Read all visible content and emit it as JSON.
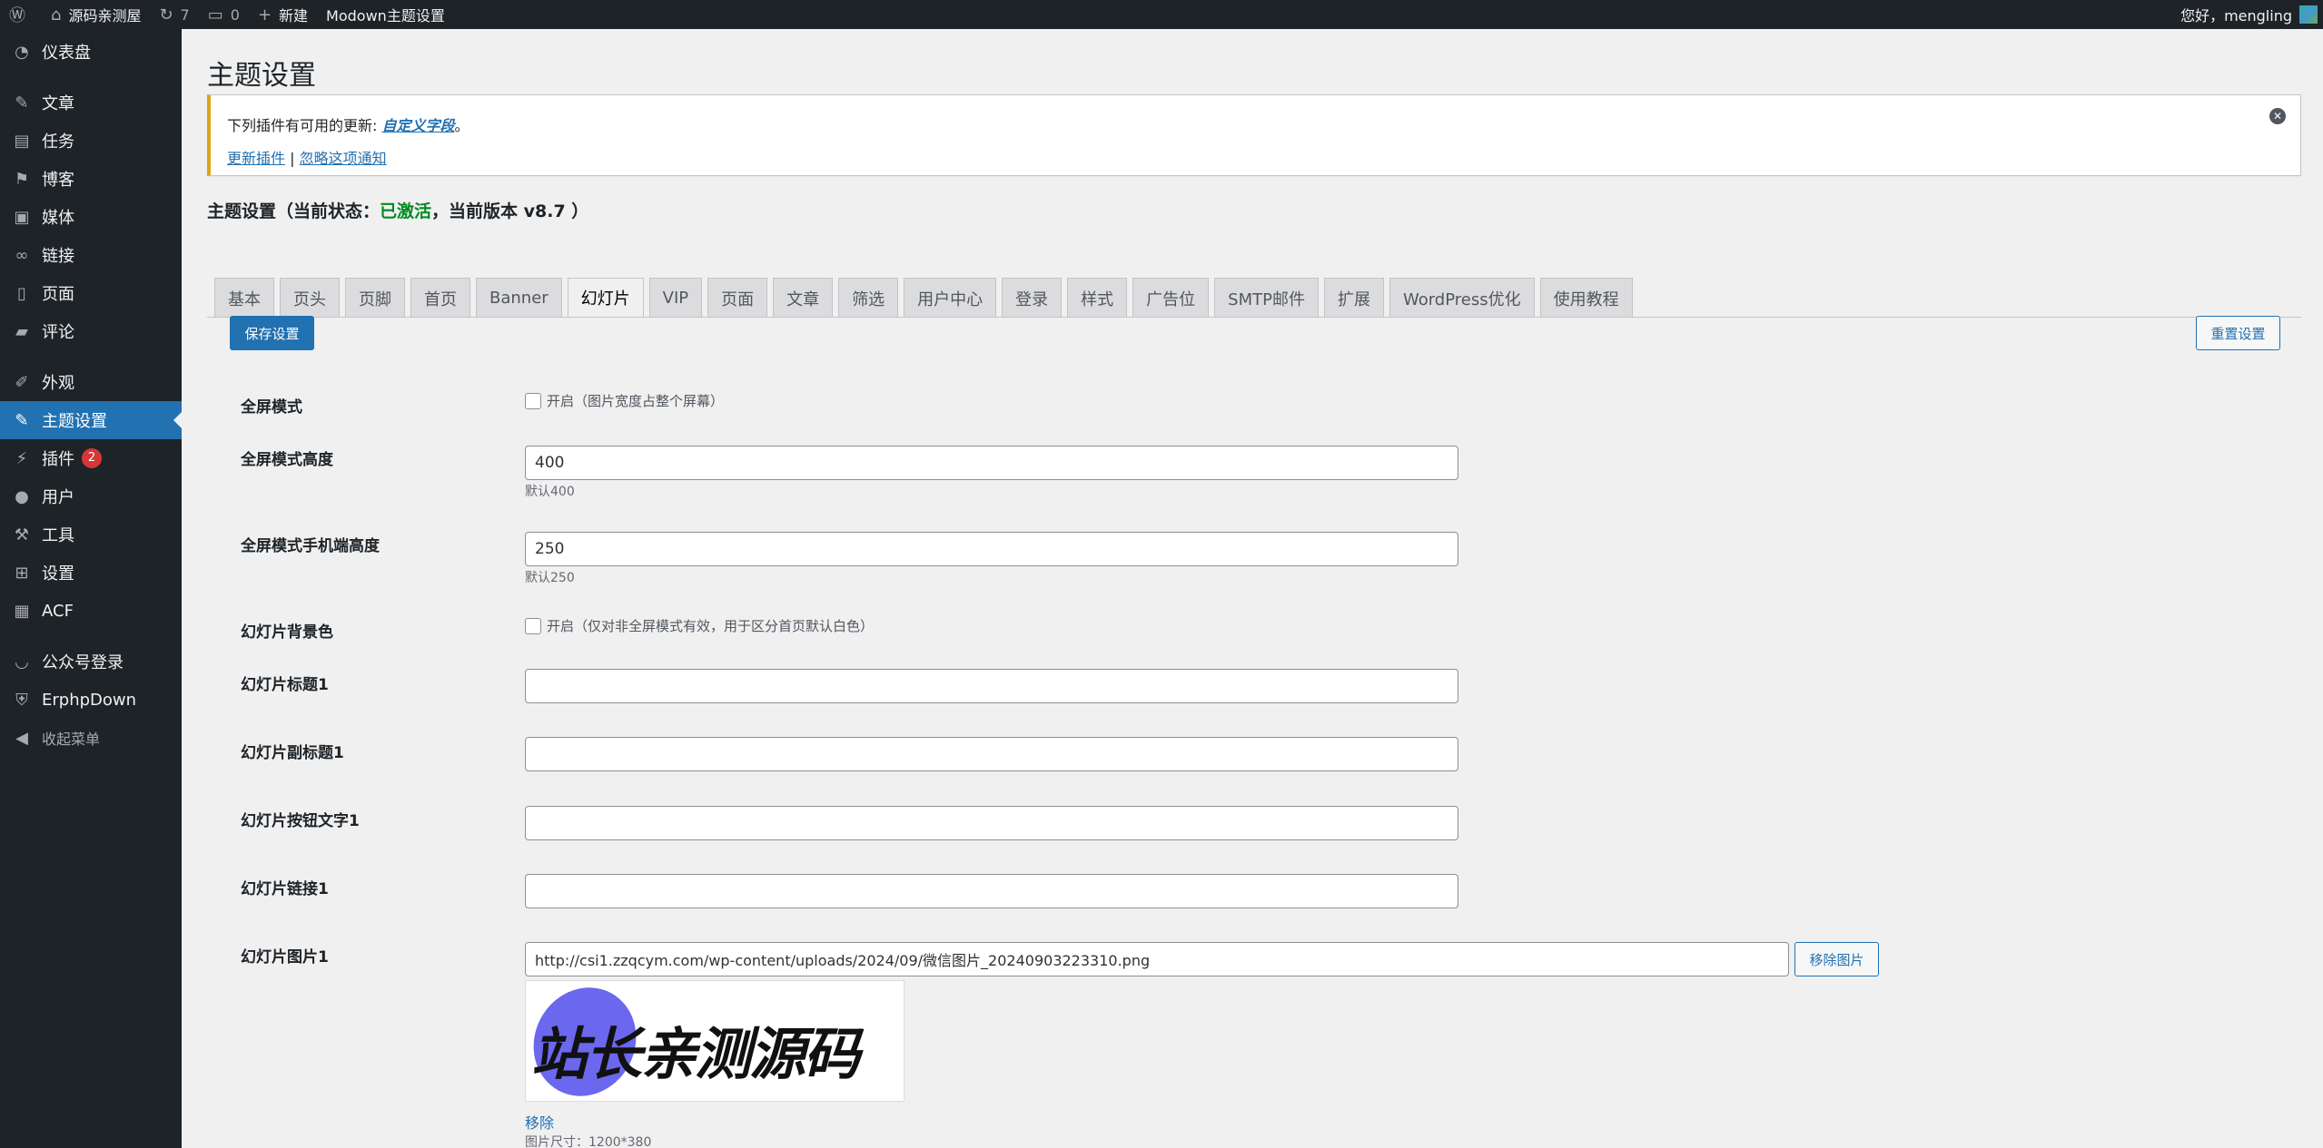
{
  "adminbar": {
    "site_name": "源码亲测屋",
    "updates_count": "7",
    "comments_count": "0",
    "new_label": "新建",
    "theme_settings_label": "Modown主题设置",
    "greeting": "您好，mengling"
  },
  "sidebar": {
    "items": [
      {
        "label": "仪表盘",
        "icon": "dashboard-icon"
      },
      {
        "label": "文章",
        "icon": "pin-icon"
      },
      {
        "label": "任务",
        "icon": "tasks-icon"
      },
      {
        "label": "博客",
        "icon": "flag-icon"
      },
      {
        "label": "媒体",
        "icon": "media-icon"
      },
      {
        "label": "链接",
        "icon": "link-icon"
      },
      {
        "label": "页面",
        "icon": "page-icon"
      },
      {
        "label": "评论",
        "icon": "comment-icon"
      },
      {
        "label": "外观",
        "icon": "appearance-icon"
      },
      {
        "label": "主题设置",
        "icon": "brush-icon"
      },
      {
        "label": "插件",
        "icon": "plugin-icon",
        "badge": "2"
      },
      {
        "label": "用户",
        "icon": "user-icon"
      },
      {
        "label": "工具",
        "icon": "wrench-icon"
      },
      {
        "label": "设置",
        "icon": "settings-icon"
      },
      {
        "label": "ACF",
        "icon": "grid-icon"
      },
      {
        "label": "公众号登录",
        "icon": "spinner-icon"
      },
      {
        "label": "ErphpDown",
        "icon": "shield-icon"
      },
      {
        "label": "收起菜单",
        "icon": "collapse-icon"
      }
    ]
  },
  "page_title": "主题设置",
  "notice": {
    "text_prefix": "下列插件有可用的更新: ",
    "plugin_link": "自定义字段",
    "text_suffix": "。",
    "update_link": "更新插件",
    "separator": " | ",
    "dismiss_link": "忽略这项通知"
  },
  "status": {
    "prefix": "主题设置（当前状态：",
    "active": "已激活",
    "suffix": "，当前版本 v8.7 ）"
  },
  "tabs": [
    "基本",
    "页头",
    "页脚",
    "首页",
    "Banner",
    "幻灯片",
    "VIP",
    "页面",
    "文章",
    "筛选",
    "用户中心",
    "登录",
    "样式",
    "广告位",
    "SMTP邮件",
    "扩展",
    "WordPress优化",
    "使用教程"
  ],
  "buttons": {
    "save": "保存设置",
    "reset": "重置设置",
    "remove_image": "移除图片"
  },
  "form": {
    "fullscreen_label": "全屏模式",
    "fullscreen_option": "开启（图片宽度占整个屏幕）",
    "fs_height_label": "全屏模式高度",
    "fs_height_value": "400",
    "fs_height_desc": "默认400",
    "fs_mobile_label": "全屏模式手机端高度",
    "fs_mobile_value": "250",
    "fs_mobile_desc": "默认250",
    "bg_label": "幻灯片背景色",
    "bg_option": "开启（仅对非全屏模式有效，用于区分首页默认白色）",
    "title1_label": "幻灯片标题1",
    "subtitle1_label": "幻灯片副标题1",
    "btn1_label": "幻灯片按钮文字1",
    "link1_label": "幻灯片链接1",
    "image1_label": "幻灯片图片1",
    "image1_url": "http://csi1.zzqcym.com/wp-content/uploads/2024/09/微信图片_20240903223310.png",
    "preview_text": "站长亲测源码",
    "remove_link": "移除",
    "image_size": "图片尺寸：1200*380"
  }
}
